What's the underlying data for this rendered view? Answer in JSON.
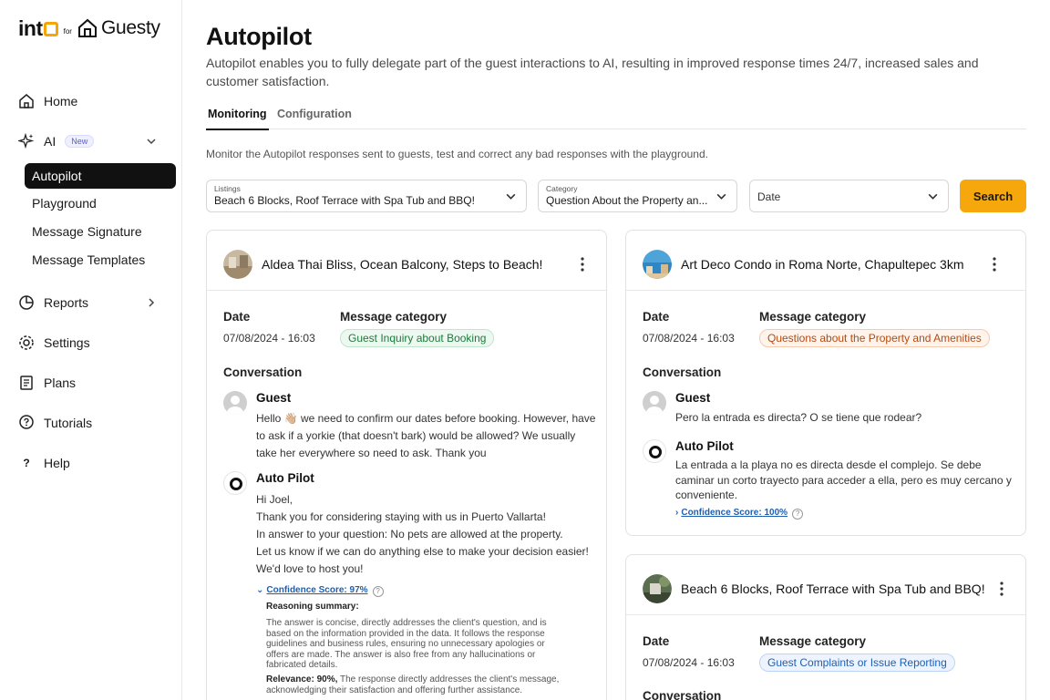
{
  "brand": {
    "into": "int",
    "for": "for",
    "partner": "Guesty"
  },
  "sidebar": {
    "home": "Home",
    "ai": "AI",
    "ai_badge": "New",
    "ai_sub": [
      "Autopilot",
      "Playground",
      "Message Signature",
      "Message Templates"
    ],
    "reports": "Reports",
    "settings": "Settings",
    "plans": "Plans",
    "tutorials": "Tutorials",
    "help": "Help"
  },
  "page": {
    "title": "Autopilot",
    "description": "Autopilot enables you to fully delegate part of the guest interactions to AI, resulting in improved response times 24/7, increased sales and customer satisfaction.",
    "tabs": [
      "Monitoring",
      "Configuration"
    ],
    "monitor_desc": "Monitor the Autopilot responses sent to guests, test and correct any bad responses with the playground."
  },
  "filters": {
    "listings_label": "Listings",
    "listings_value": "Beach 6 Blocks, Roof Terrace with Spa Tub and BBQ!",
    "category_label": "Category",
    "category_value": "Question About the Property an...",
    "date_placeholder": "Date",
    "search_label": "Search"
  },
  "labels": {
    "date": "Date",
    "message_category": "Message category",
    "conversation": "Conversation",
    "guest": "Guest",
    "autopilot": "Auto Pilot"
  },
  "cards": [
    {
      "title": "Aldea Thai Bliss, Ocean Balcony, Steps to Beach!",
      "date": "07/08/2024 - 16:03",
      "category": "Guest Inquiry about Booking",
      "guest_lines": [
        "Hello 👋🏼 we need to confirm our dates before booking. However, have",
        "to ask if a yorkie (that doesn't bark) would be allowed? We usually",
        "take her everywhere so need to ask. Thank you"
      ],
      "bot_lines": [
        "Hi Joel,",
        "Thank you for considering staying with us in Puerto Vallarta!",
        "In answer to your question: No pets are allowed at the property.",
        "Let us know if we can do anything else to make your decision easier!",
        "We'd love to host you!"
      ],
      "confidence": "Confidence Score: 97%",
      "reasoning_title": "Reasoning summary:",
      "reasoning_lines": [
        "The answer is concise, directly addresses the client's question, and is",
        "based on the information provided in the data. It follows the response",
        "guidelines and business rules, ensuring no unnecessary apologies or",
        "offers are made. The answer is also free from any hallucinations or",
        "fabricated details."
      ],
      "relevance_label": "Relevance: 90%,",
      "relevance_lines": [
        " The response directly addresses the client's message,",
        "acknowledging their satisfaction and offering further assistance."
      ]
    },
    {
      "title": "Art Deco Condo in Roma Norte, Chapultepec 3km",
      "date": "07/08/2024 - 16:03",
      "category": "Questions about the Property and Amenities",
      "guest_lines": [
        "Pero la entrada es directa? O se tiene que rodear?"
      ],
      "bot_lines": [
        "La entrada a la playa no es directa desde el complejo. Se debe",
        "caminar un corto trayecto para acceder a ella, pero es muy cercano y",
        "conveniente."
      ],
      "confidence": "Confidence Score: 100%"
    },
    {
      "title": "Beach 6 Blocks, Roof Terrace with Spa Tub and BBQ!",
      "date": "07/08/2024 - 16:03",
      "category": "Guest Complaints or Issue Reporting"
    }
  ],
  "colors": {
    "accent": "#f6a70c",
    "active_nav": "#111111",
    "link": "#1f5fb0"
  }
}
